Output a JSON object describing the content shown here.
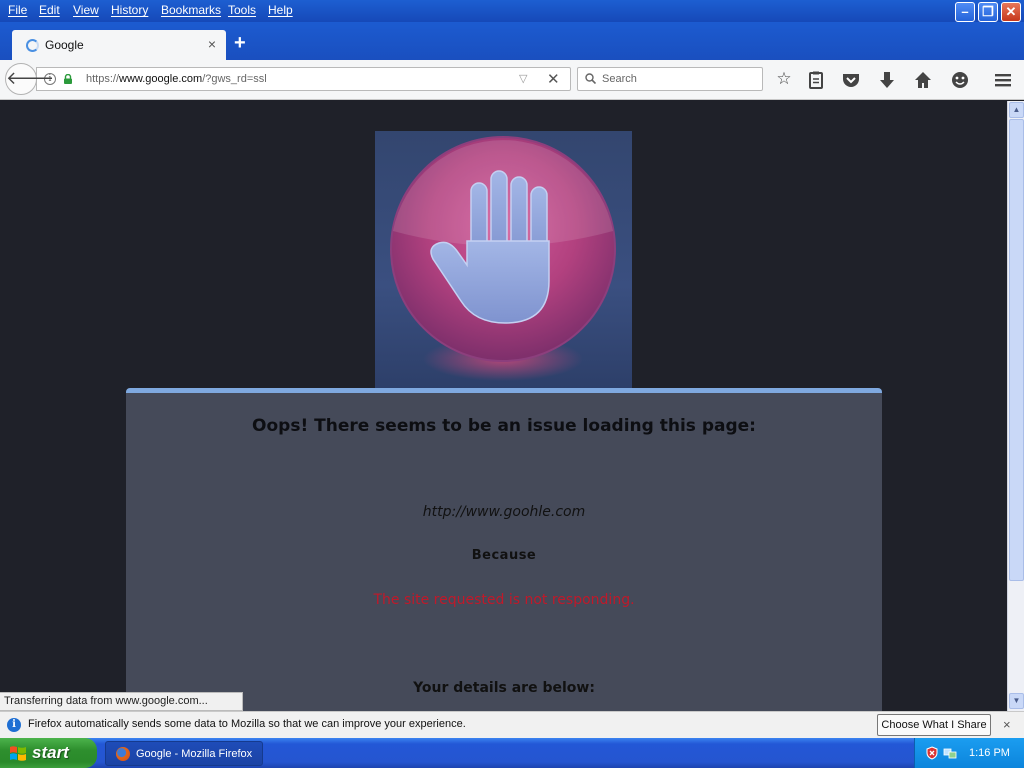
{
  "menu": {
    "file": "File",
    "edit": "Edit",
    "view": "View",
    "history": "History",
    "bookmarks": "Bookmarks",
    "tools": "Tools",
    "help": "Help"
  },
  "window_controls": {
    "minimize": "–",
    "maximize": "❐",
    "close": "✕"
  },
  "tab": {
    "title": "Google",
    "close": "×",
    "new_tab": "+"
  },
  "nav": {
    "url_prefix": "https://",
    "url_host": "www.google.com",
    "url_path": "/?gws_rd=ssl",
    "search_placeholder": "Search",
    "search_value": ""
  },
  "page": {
    "heading": "Oops! There seems to be an issue loading this page:",
    "url": "http://www.goohle.com",
    "because": "Because",
    "reason": "The site requested is not responding.",
    "details": "Your details are below:"
  },
  "status": {
    "text": "Transferring data from www.google.com..."
  },
  "notification": {
    "text": "Firefox automatically sends some data to Mozilla so that we can improve your experience.",
    "button": "Choose What I Share",
    "close": "×"
  },
  "taskbar": {
    "start": "start",
    "task": "Google - Mozilla Firefox",
    "clock": "1:16 PM"
  },
  "colors": {
    "accent": "#1d5fd1",
    "error_red": "#c0192a",
    "card_bg": "#454a59",
    "page_bg": "#1f2129"
  },
  "icons": {
    "back": "arrow-left-icon",
    "info": "info-icon",
    "lock": "lock-icon",
    "stop": "stop-icon",
    "search": "search-icon",
    "bookmark": "star-icon",
    "reader": "clipboard-icon",
    "pocket": "pocket-icon",
    "download": "download-icon",
    "home": "home-icon",
    "hello": "smiley-icon",
    "menu": "hamburger-menu-icon",
    "stop_hand": "stop-hand-icon"
  }
}
